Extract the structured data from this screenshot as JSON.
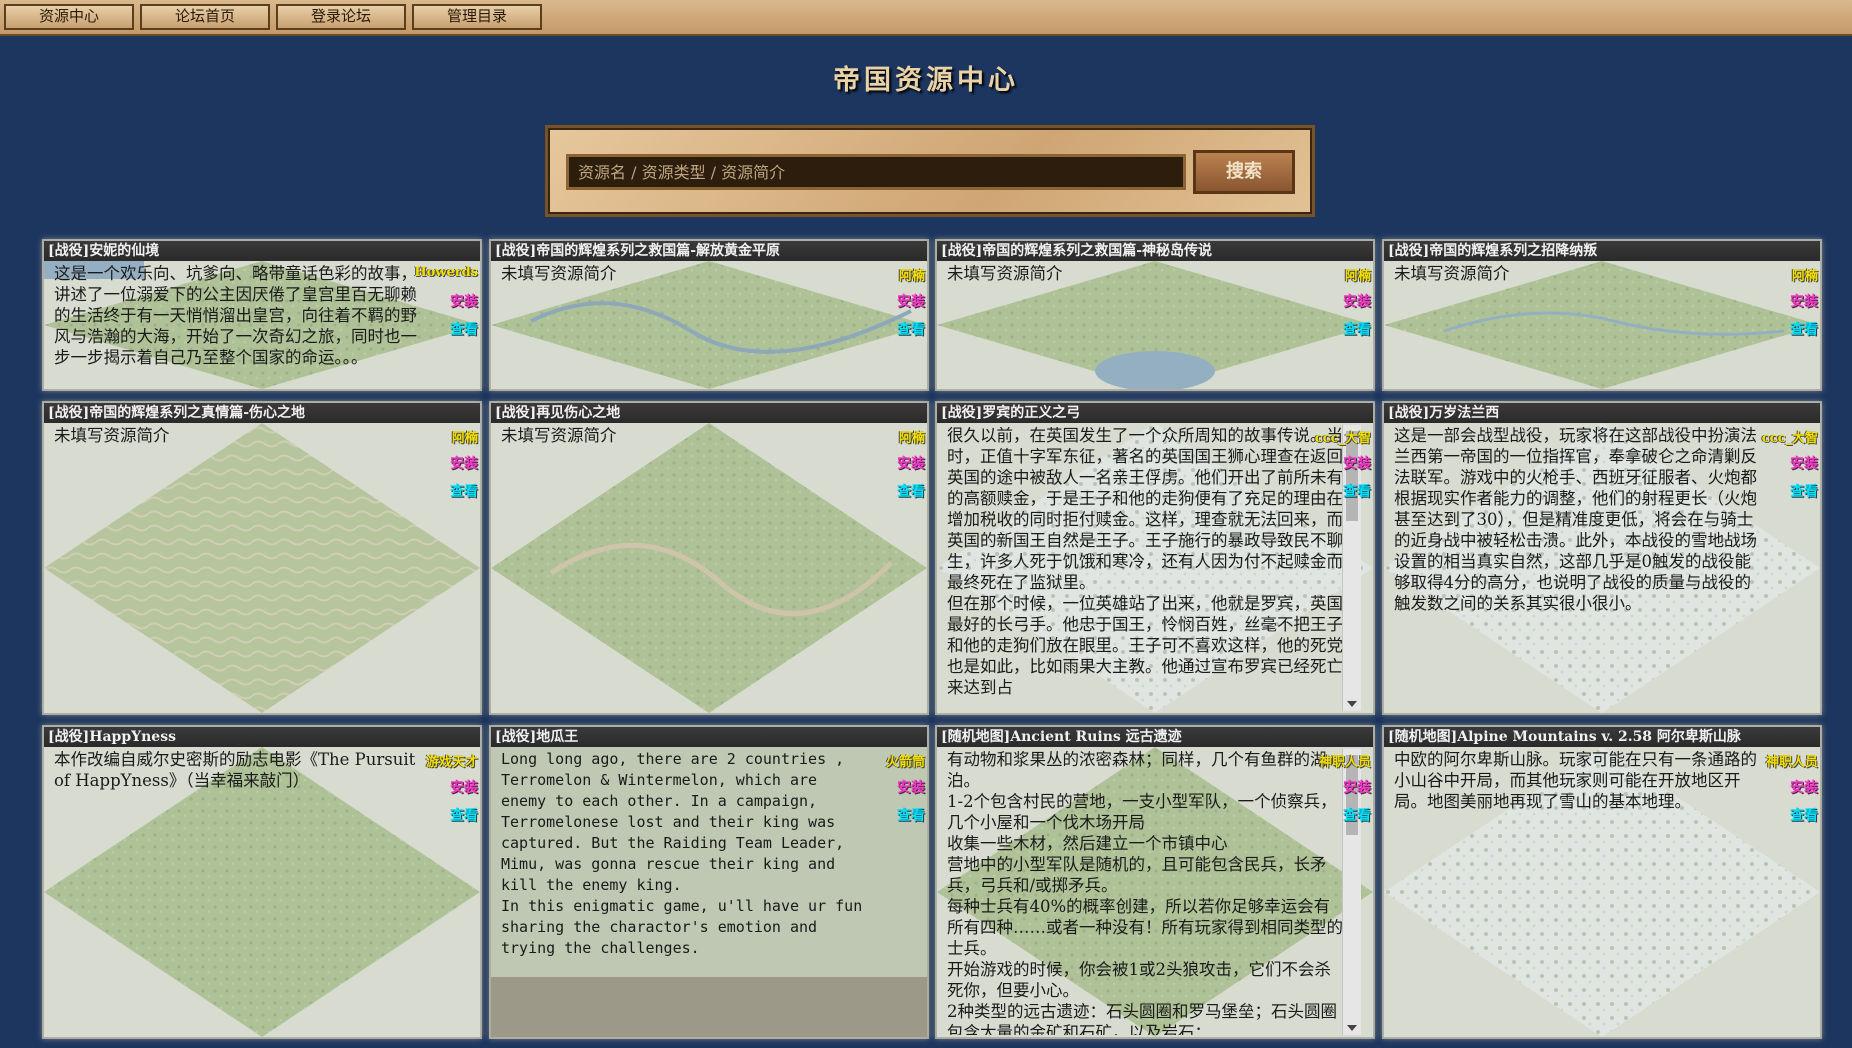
{
  "nav": {
    "items": [
      "资源中心",
      "论坛首页",
      "登录论坛",
      "管理目录"
    ]
  },
  "page_title": "帝国资源中心",
  "search": {
    "placeholder": "资源名 / 资源类型 / 资源简介",
    "button_label": "搜索"
  },
  "actions": {
    "install_label": "安装",
    "view_label": "查看"
  },
  "cards": [
    {
      "title": "[战役]安妮的仙境",
      "author": "Howerds",
      "desc": "这是一个欢乐向、坑爹向、略带童话色彩的故事，讲述了一位溺爱下的公主因厌倦了皇宫里百无聊赖的生活终于有一天悄悄溜出皇宫，向往着不羁的野风与浩瀚的大海，开始了一次奇幻之旅，同时也一步一步揭示着自己乃至整个国家的命运。。。"
    },
    {
      "title": "[战役]帝国的辉煌系列之救国篇-解放黄金平原",
      "author": "阿楠",
      "desc": "未填写资源简介"
    },
    {
      "title": "[战役]帝国的辉煌系列之救国篇-神秘岛传说",
      "author": "阿楠",
      "desc": "未填写资源简介"
    },
    {
      "title": "[战役]帝国的辉煌系列之招降纳叛",
      "author": "阿楠",
      "desc": "未填写资源简介"
    },
    {
      "title": "[战役]帝国的辉煌系列之真情篇-伤心之地",
      "author": "阿楠",
      "desc": "未填写资源简介"
    },
    {
      "title": "[战役]再见伤心之地",
      "author": "阿楠",
      "desc": "未填写资源简介"
    },
    {
      "title": "[战役]罗宾的正义之弓",
      "author": "ccc_大智",
      "desc": "很久以前，在英国发生了一个众所周知的故事传说。当时，正值十字军东征，著名的英国国王狮心理查在返回英国的途中被敌人一名亲王俘虏。他们开出了前所未有的高额赎金，于是王子和他的走狗便有了充足的理由在增加税收的同时拒付赎金。这样，理查就无法回来，而英国的新国王自然是王子。王子施行的暴政导致民不聊生，许多人死于饥饿和寒冷，还有人因为付不起赎金而最终死在了监狱里。\n但在那个时候，一位英雄站了出来，他就是罗宾，英国最好的长弓手。他忠于国王，怜悯百姓，丝毫不把王子和他的走狗们放在眼里。王子可不喜欢这样，他的死党也是如此，比如雨果大主教。他通过宣布罗宾已经死亡来达到占"
    },
    {
      "title": "[战役]万岁法兰西",
      "author": "ccc_大智",
      "desc": "这是一部会战型战役，玩家将在这部战役中扮演法兰西第一帝国的一位指挥官，奉拿破仑之命清剿反法联军。游戏中的火枪手、西班牙征服者、火炮都根据现实作者能力的调整，他们的射程更长（火炮甚至达到了30），但是精准度更低，将会在与骑士的近身战中被轻松击溃。此外，本战役的雪地战场设置的相当真实自然，这部几乎是0触发的战役能够取得4分的高分，也说明了战役的质量与战役的触发数之间的关系其实很小很小。"
    },
    {
      "title": "[战役]HappYness",
      "author": "游戏天才",
      "desc": "本作改编自威尔史密斯的励志电影《The Pursuit of HappYness》（当幸福来敲门）"
    },
    {
      "title": "[战役]地瓜王",
      "author": "火箭筒",
      "desc": "Long long ago, there are 2 countries , Terromelon & Wintermelon, which are enemy to each other. In a campaign, Terromelonese lost and their king was captured. But the Raiding Team Leader, Mimu, was gonna rescue their king and kill the enemy king.\nIn this enigmatic game, u'll have ur fun sharing the charactor's emotion and trying the challenges."
    },
    {
      "title": "[随机地图]Ancient Ruins 远古遗迹",
      "author": "神职人员",
      "desc": "有动物和浆果丛的浓密森林；同样，几个有鱼群的湖泊。\n1-2个包含村民的营地，一支小型军队，一个侦察兵，几个小屋和一个伐木场开局\n收集一些木材，然后建立一个市镇中心\n营地中的小型军队是随机的，且可能包含民兵，长矛兵，弓兵和/或掷矛兵。\n每种士兵有40%的概率创建，所以若你足够幸运会有所有四种……或者一种没有！所有玩家得到相同类型的士兵。\n开始游戏的时候，你会被1或2头狼攻击，它们不会杀死你，但要小心。\n2种类型的远古遗迹：石头圆圈和罗马堡垒；石头圆圈包含大量的金矿和石矿，以及岩石："
    },
    {
      "title": "[随机地图]Alpine Mountains v. 2.58 阿尔卑斯山脉",
      "author": "神职人员",
      "desc": "中欧的阿尔卑斯山脉。玩家可能在只有一条通路的小山谷中开局，而其他玩家则可能在开放地区开局。地图美丽地再现了雪山的基本地理。"
    }
  ]
}
